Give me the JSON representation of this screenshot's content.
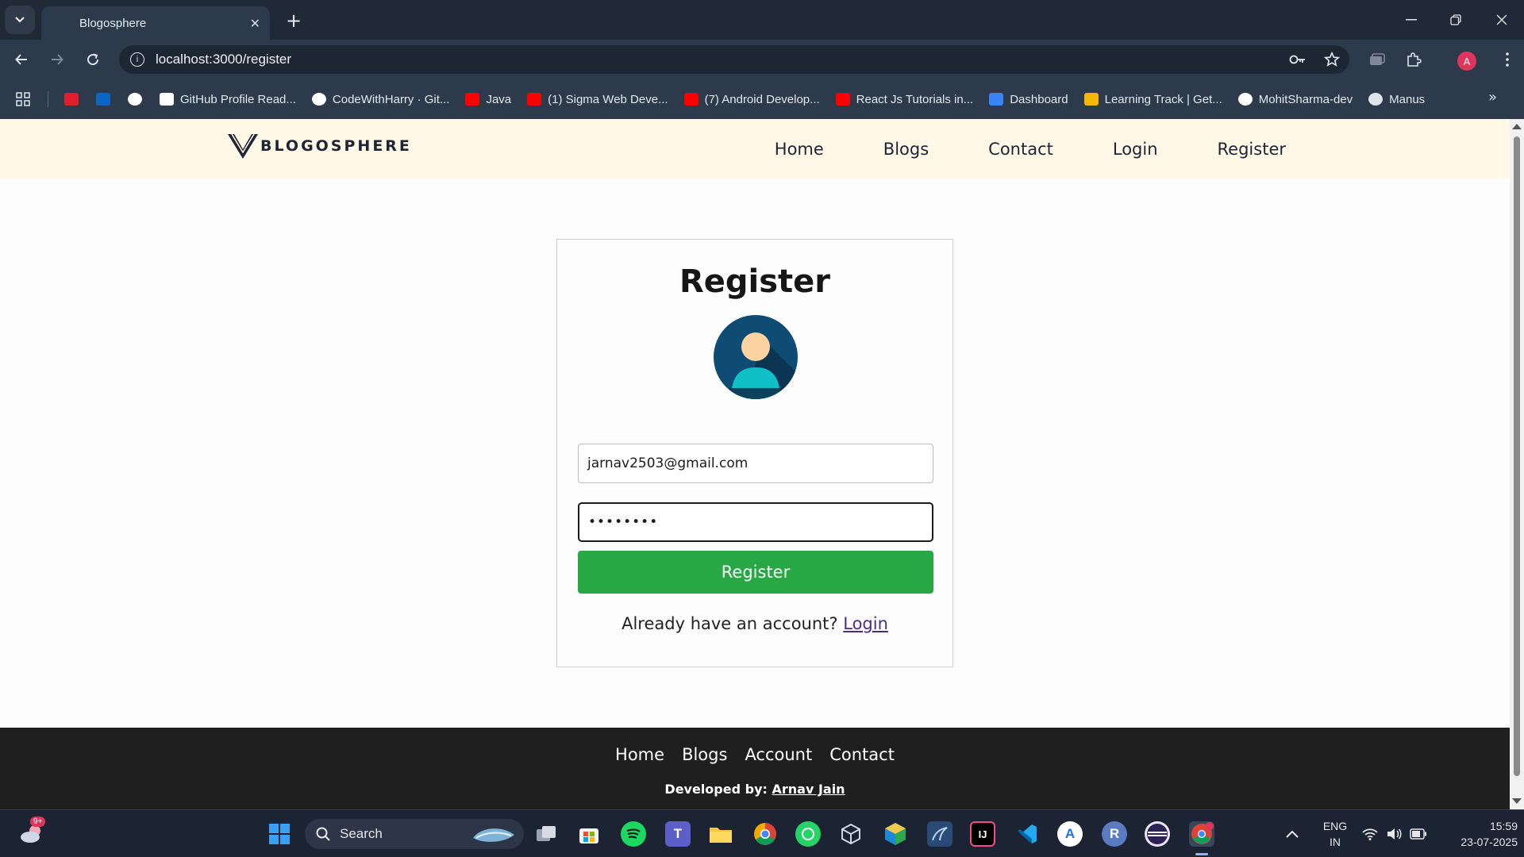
{
  "browser": {
    "tab_title": "Blogosphere",
    "url": "localhost:3000/register",
    "profile_initial": "A",
    "bookmarks": [
      {
        "label": "",
        "icon": "vivaldi-icon",
        "color": "#e11d2e"
      },
      {
        "label": "",
        "icon": "linkedin-icon",
        "color": "#0a66c2"
      },
      {
        "label": "",
        "icon": "github-icon",
        "color": "#ffffff"
      },
      {
        "label": "GitHub Profile Read...",
        "icon": "readme-icon",
        "color": "#ffffff"
      },
      {
        "label": "CodeWithHarry · Git...",
        "icon": "github-icon",
        "color": "#ffffff"
      },
      {
        "label": "Java",
        "icon": "youtube-icon",
        "color": "#ff0000"
      },
      {
        "label": "(1) Sigma Web Deve...",
        "icon": "youtube-icon",
        "color": "#ff0000"
      },
      {
        "label": "(7) Android Develop...",
        "icon": "youtube-icon",
        "color": "#ff0000"
      },
      {
        "label": "React Js Tutorials in...",
        "icon": "youtube-icon",
        "color": "#ff0000"
      },
      {
        "label": "Dashboard",
        "icon": "dashboard-icon",
        "color": "#3b82f6"
      },
      {
        "label": "Learning Track | Get...",
        "icon": "chart-icon",
        "color": "#f5b700"
      },
      {
        "label": "MohitSharma-dev",
        "icon": "github-icon",
        "color": "#ffffff"
      },
      {
        "label": "Manus",
        "icon": "manus-icon",
        "color": "#dfe4ea"
      }
    ]
  },
  "site": {
    "logo_text": "BLOGOSPHERE",
    "nav": [
      "Home",
      "Blogs",
      "Contact",
      "Login",
      "Register"
    ],
    "form": {
      "title": "Register",
      "email_value": "jarnav2503@gmail.com",
      "password_value": "••••••••",
      "submit_label": "Register",
      "login_prompt": "Already have an account?",
      "login_link": "Login"
    },
    "footer": {
      "nav": [
        "Home",
        "Blogs",
        "Account",
        "Contact"
      ],
      "credit_prefix": "Developed by:",
      "credit_name": "Arnav Jain"
    }
  },
  "taskbar": {
    "search_label": "Search",
    "weather_badge": "9+",
    "lang_line1": "ENG",
    "lang_line2": "IN",
    "time": "15:59",
    "date": "23-07-2025"
  },
  "colors": {
    "header_bg": "#fff8e7",
    "submit_bg": "#28a745",
    "footer_bg": "#1f1f1f",
    "link": "#4b2a8c"
  }
}
